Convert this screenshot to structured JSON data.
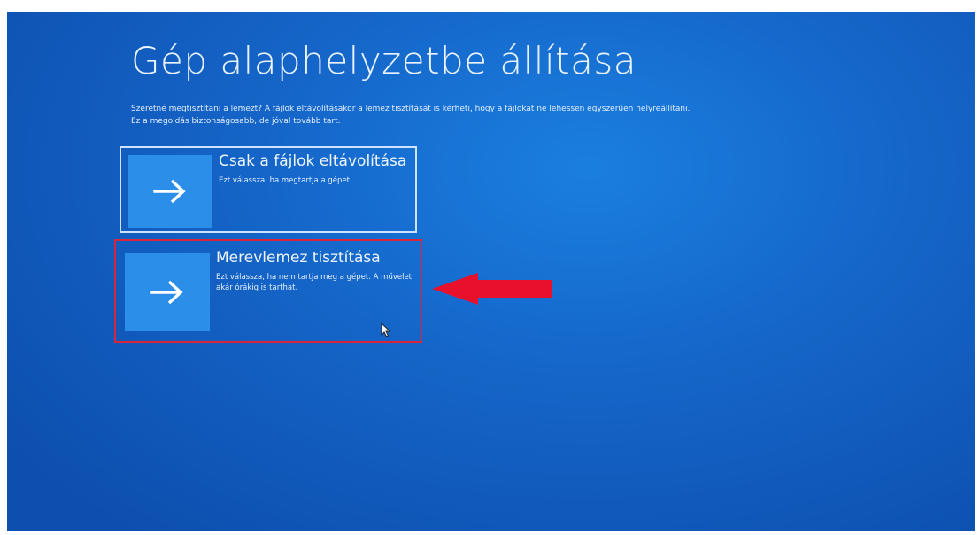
{
  "page": {
    "title": "Gép alaphelyzetbe állítása",
    "description": "Szeretné megtisztítani a lemezt? A fájlok eltávolításakor a lemez tisztítását is kérheti, hogy a fájlokat ne lehessen egyszerűen helyreállítani. Ez a megoldás biztonságosabb, de jóval tovább tart."
  },
  "options": [
    {
      "title": "Csak a fájlok eltávolítása",
      "subtitle": "Ezt válassza, ha megtartja a gépet.",
      "icon": "arrow-right-icon"
    },
    {
      "title": "Merevlemez tisztítása",
      "subtitle": "Ezt válassza, ha nem tartja meg a gépet. A művelet akár órákig is tarthat.",
      "icon": "arrow-right-icon"
    }
  ],
  "annotations": {
    "highlight_color": "#d9243a",
    "pointer_arrow_color": "#e8102a"
  },
  "colors": {
    "background": "#1565c8",
    "tile": "#2b8ee8"
  }
}
